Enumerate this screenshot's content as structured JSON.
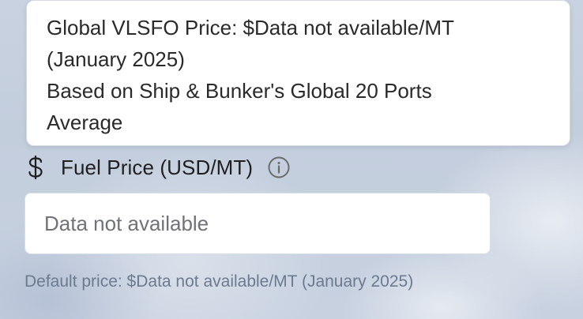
{
  "tooltip": {
    "line1": "Global VLSFO Price: $Data not available/MT",
    "line2": "(January 2025)",
    "line3": "Based on Ship & Bunker's Global 20 Ports",
    "line4": "Average"
  },
  "fuel_price": {
    "label": "Fuel Price (USD/MT)",
    "placeholder": "Data not available",
    "value": "",
    "helper": "Default price: $Data not available/MT (January 2025)"
  },
  "icons": {
    "label_icon": "dollar-icon",
    "info_icon": "info-icon"
  },
  "colors": {
    "tooltip_bg": "#ffffff",
    "label_text": "#1f1f1f",
    "helper_text": "#6c7a90",
    "icon_stroke": "#6b6b6b"
  }
}
